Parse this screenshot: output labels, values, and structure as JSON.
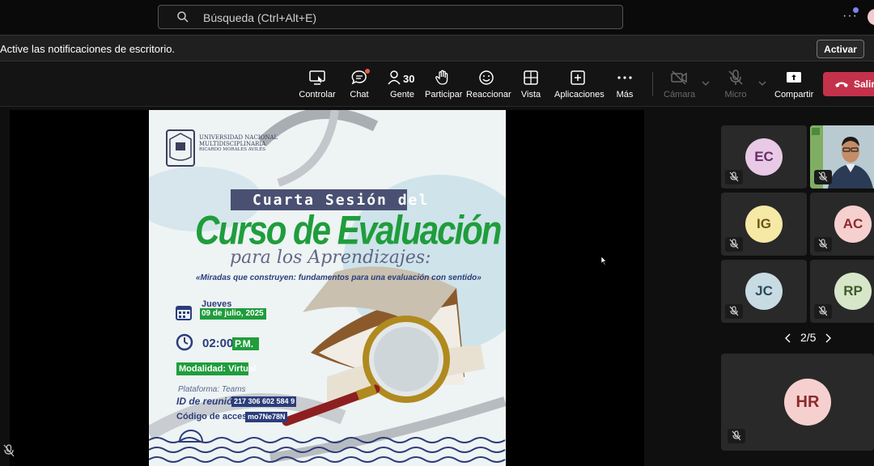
{
  "search": {
    "placeholder": "Búsqueda (Ctrl+Alt+E)"
  },
  "notification": {
    "text": "Active las notificaciones de escritorio.",
    "button": "Activar"
  },
  "toolbar": {
    "controlar": "Controlar",
    "chat": "Chat",
    "gente": "Gente",
    "gente_count": "30",
    "participar": "Participar",
    "reaccionar": "Reaccionar",
    "vista": "Vista",
    "aplicaciones": "Aplicaciones",
    "mas": "Más",
    "camara": "Cámara",
    "micro": "Micro",
    "compartir": "Compartir",
    "salir": "Salir"
  },
  "poster": {
    "uni_line1": "Universidad Nacional",
    "uni_line2": "Multidisciplinaria",
    "uni_line3": "Ricardo Morales Avilés",
    "banner": "Cuarta Sesión del",
    "title": "Curso de Evaluación",
    "script": "para los Aprendizajes:",
    "subtitle": "«Miradas que construyen: fundamentos para una evaluación con sentido»",
    "day": "Jueves",
    "date": "09 de julio, 2025",
    "time": "02:00",
    "ampm": "P.M.",
    "modalidad": "Modalidad: Virtual",
    "plataforma": "Plataforma: Teams",
    "id_label": "ID de reunión:",
    "id_value": "217 306 602 584 9",
    "code_label": "Código de acceso:",
    "code_value": "mo7Ne78N"
  },
  "participants": [
    {
      "initials": "EC",
      "bg": "#e8c9e6",
      "fg": "#6b2c66"
    },
    {
      "initials": "IG",
      "bg": "#f6e8a5",
      "fg": "#6b5614"
    },
    {
      "initials": "AC",
      "bg": "#f6d0cf",
      "fg": "#8a2b2b"
    },
    {
      "initials": "JC",
      "bg": "#c8dbe3",
      "fg": "#2c4c5a"
    },
    {
      "initials": "RP",
      "bg": "#d7e6c9",
      "fg": "#3f5a2a"
    },
    {
      "initials": "HR",
      "bg": "#f6d0cf",
      "fg": "#8a2b2b"
    }
  ],
  "pager": "2/5",
  "colors": {
    "leave": "#c4314b",
    "poster_green": "#1f9d3c",
    "banner": "#4a5072"
  }
}
